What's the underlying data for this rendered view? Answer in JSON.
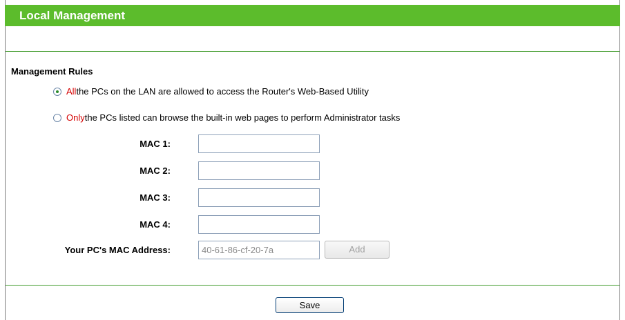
{
  "page": {
    "title": "Local Management"
  },
  "rules": {
    "section_title": "Management Rules",
    "option_all": {
      "keyword": "All",
      "text": " the PCs on the LAN are allowed to access the Router's Web-Based Utility",
      "selected": true
    },
    "option_only": {
      "keyword": "Only",
      "text": " the PCs listed can browse the built-in web pages to perform Administrator tasks",
      "selected": false
    }
  },
  "mac_fields": [
    {
      "label": "MAC 1:",
      "value": ""
    },
    {
      "label": "MAC 2:",
      "value": ""
    },
    {
      "label": "MAC 3:",
      "value": ""
    },
    {
      "label": "MAC 4:",
      "value": ""
    }
  ],
  "your_mac": {
    "label": "Your PC's MAC Address:",
    "value": "40-61-86-cf-20-7a",
    "add_label": "Add"
  },
  "footer": {
    "save_label": "Save"
  },
  "colors": {
    "header_green": "#5cbc2c",
    "rule_green": "#3f9a2a",
    "keyword_red": "#d40000"
  }
}
